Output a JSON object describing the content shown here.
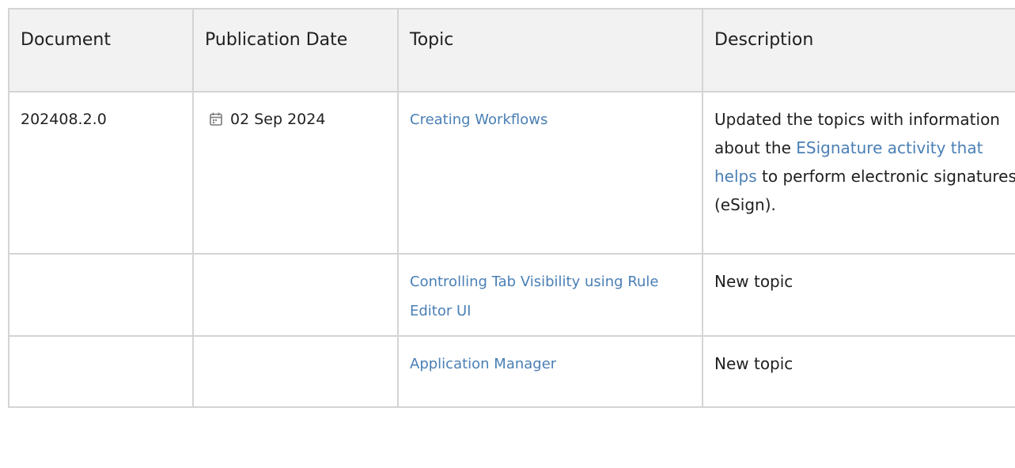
{
  "headers": {
    "document": "Document",
    "publication_date": "Publication Date",
    "topic": "Topic",
    "description": "Description"
  },
  "rows": [
    {
      "document": "202408.2.0",
      "date": "02 Sep 2024",
      "topic": "Creating Workflows",
      "description": {
        "before": "Updated the topics with information about the ",
        "link": "ESignature activity that helps",
        "after": " to perform electronic signatures (eSign)."
      }
    },
    {
      "document": "",
      "date": "",
      "topic": "Controlling Tab Visibility using Rule Editor UI",
      "description": {
        "before": "New topic",
        "link": "",
        "after": ""
      }
    },
    {
      "document": "",
      "date": "",
      "topic": "Application Manager",
      "description": {
        "before": "New topic",
        "link": "",
        "after": ""
      }
    }
  ],
  "icons": {
    "date_icon": "calendar-icon"
  },
  "colors": {
    "link": "#4a7fb5",
    "header_bg": "#f2f2f2",
    "border": "#d4d4d4"
  }
}
